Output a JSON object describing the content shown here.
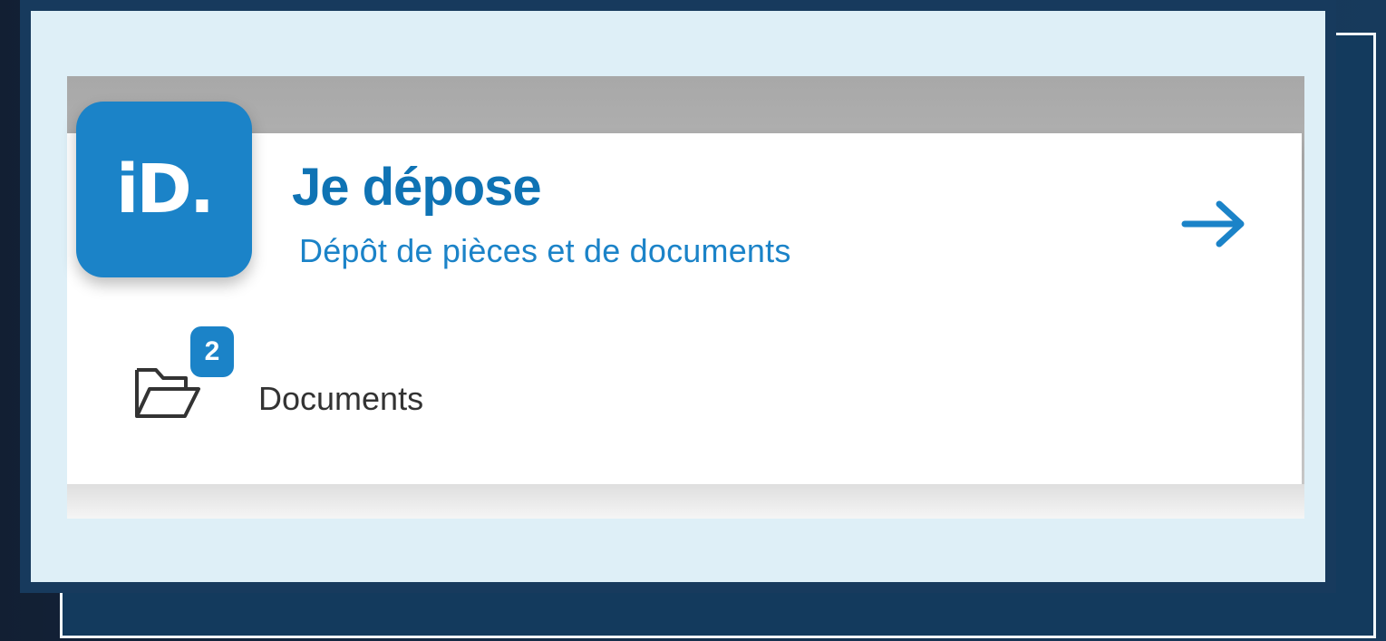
{
  "service_card": {
    "logo_text": "iD.",
    "title": "Je dépose",
    "subtitle": "Dépôt de pièces et de documents",
    "arrow_icon": "arrow-right-icon",
    "documents_link": {
      "badge_count": "2",
      "label": "Documents",
      "icon": "folder-icon"
    }
  },
  "colors": {
    "primary_blue": "#1b83c8",
    "title_blue": "#0f73b4",
    "frame_navy": "#173a5d",
    "panel_bg": "#deeff7"
  }
}
